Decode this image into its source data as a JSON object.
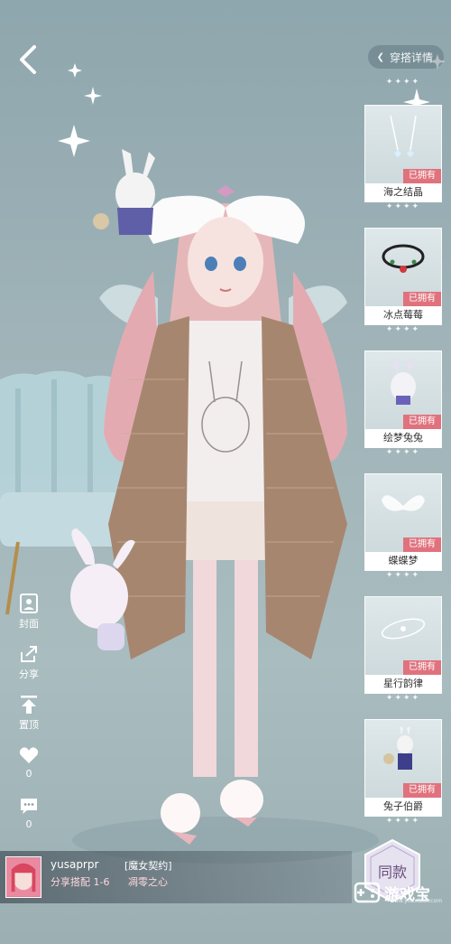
{
  "header": {
    "detail_label": "穿搭详情"
  },
  "items": [
    {
      "name": "海之结晶",
      "status": "已拥有",
      "icon": "crystal-earring-icon"
    },
    {
      "name": "冰点莓莓",
      "status": "已拥有",
      "icon": "berry-choker-icon"
    },
    {
      "name": "绘梦兔兔",
      "status": "已拥有",
      "icon": "bunny-plush-icon"
    },
    {
      "name": "蝶蝶梦",
      "status": "已拥有",
      "icon": "butterfly-wings-icon"
    },
    {
      "name": "星行韵律",
      "status": "已拥有",
      "icon": "star-orbit-icon"
    },
    {
      "name": "兔子伯爵",
      "status": "已拥有",
      "icon": "rabbit-count-icon"
    }
  ],
  "side_actions": [
    {
      "label": "封面",
      "icon": "cover-portrait-icon"
    },
    {
      "label": "分享",
      "icon": "share-icon"
    },
    {
      "label": "置顶",
      "icon": "pin-top-icon"
    },
    {
      "label": "0",
      "icon": "heart-icon"
    },
    {
      "label": "0",
      "icon": "comment-icon"
    }
  ],
  "user": {
    "name": "yusaprpr",
    "outfit_tag": "[魔女契约]",
    "share_info": "分享搭配 1-6",
    "series_name": "凋零之心"
  },
  "same_button_label": "同款",
  "watermark": {
    "text": "游戏宝",
    "url": "www.youxibao.com"
  },
  "colors": {
    "owned_badge": "#e0727d",
    "background": "#9fb3b8"
  }
}
